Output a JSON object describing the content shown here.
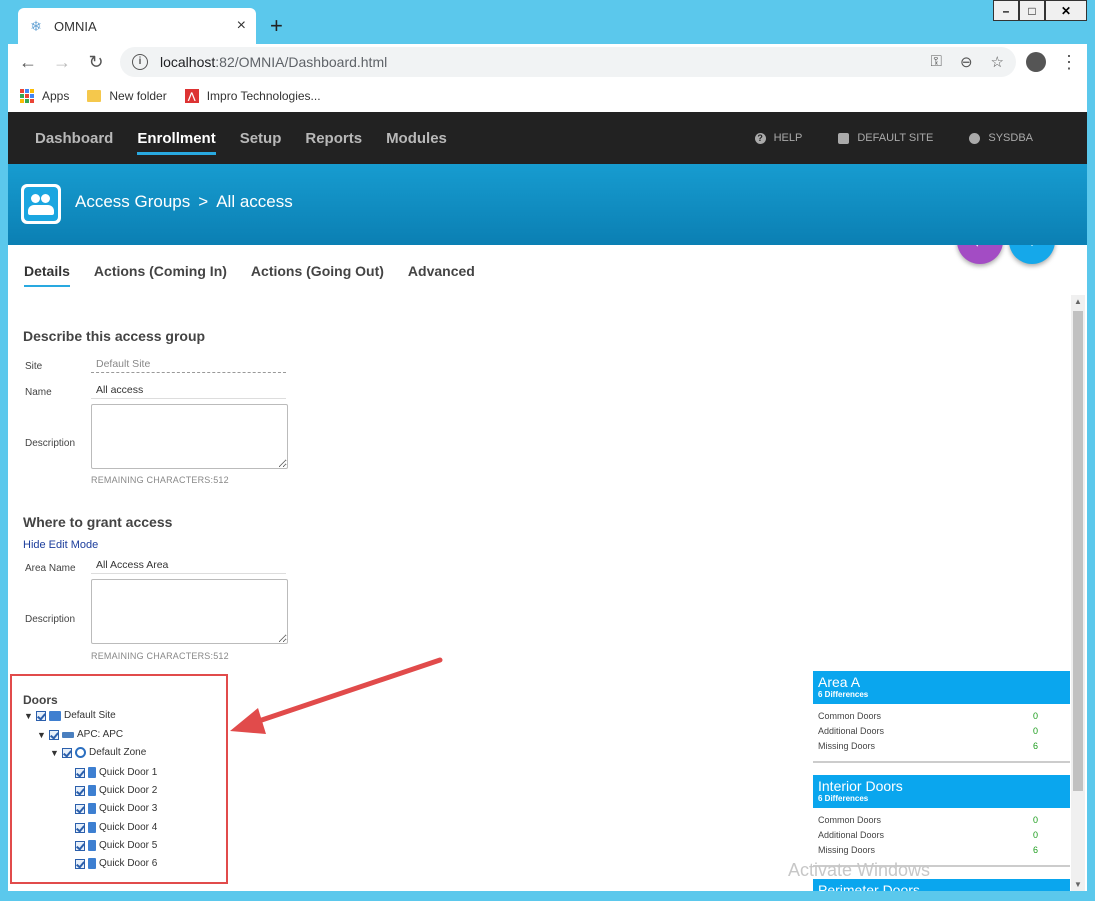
{
  "browser": {
    "tab_title": "OMNIA",
    "tab_close": "×",
    "new_tab": "+",
    "url_host": "localhost",
    "url_path": ":82/OMNIA/Dashboard.html",
    "bookmarks": [
      "Apps",
      "New folder",
      "Impro Technologies..."
    ]
  },
  "nav": {
    "items": [
      "Dashboard",
      "Enrollment",
      "Setup",
      "Reports",
      "Modules"
    ],
    "help": "HELP",
    "site": "DEFAULT SITE",
    "user": "SYSDBA"
  },
  "header": {
    "crumb1": "Access Groups",
    "sep": ">",
    "crumb2": "All access"
  },
  "tabs": [
    "Details",
    "Actions (Coming In)",
    "Actions (Going Out)",
    "Advanced"
  ],
  "describe": {
    "title": "Describe this access group",
    "site_label": "Site",
    "site_value": "Default Site",
    "name_label": "Name",
    "name_value": "All access",
    "desc_label": "Description",
    "remaining": "REMAINING CHARACTERS:512"
  },
  "grant": {
    "title": "Where to grant access",
    "toggle": "Hide Edit Mode",
    "area_label": "Area Name",
    "area_value": "All Access Area",
    "desc_label": "Description",
    "remaining": "REMAINING CHARACTERS:512"
  },
  "doors": {
    "title": "Doors",
    "site": "Default Site",
    "controller": "APC: APC",
    "zone": "Default Zone",
    "items": [
      "Quick Door 1",
      "Quick Door 2",
      "Quick Door 3",
      "Quick Door 4",
      "Quick Door 5",
      "Quick Door 6"
    ]
  },
  "areas": [
    {
      "name": "Area A",
      "diff": "6 Differences",
      "rows": [
        [
          "Common Doors",
          "0"
        ],
        [
          "Additional Doors",
          "0"
        ],
        [
          "Missing Doors",
          "6"
        ]
      ]
    },
    {
      "name": "Interior Doors",
      "diff": "6 Differences",
      "rows": [
        [
          "Common Doors",
          "0"
        ],
        [
          "Additional Doors",
          "0"
        ],
        [
          "Missing Doors",
          "6"
        ]
      ]
    },
    {
      "name": "Perimeter Doors"
    }
  ],
  "watermark": "Activate Windows",
  "colors": {
    "accent": "#29a9e0",
    "band": "#0b7fb3",
    "back_fab": "#a34cc4",
    "add_fab": "#15a8ea",
    "highlight": "#e14b4b"
  }
}
